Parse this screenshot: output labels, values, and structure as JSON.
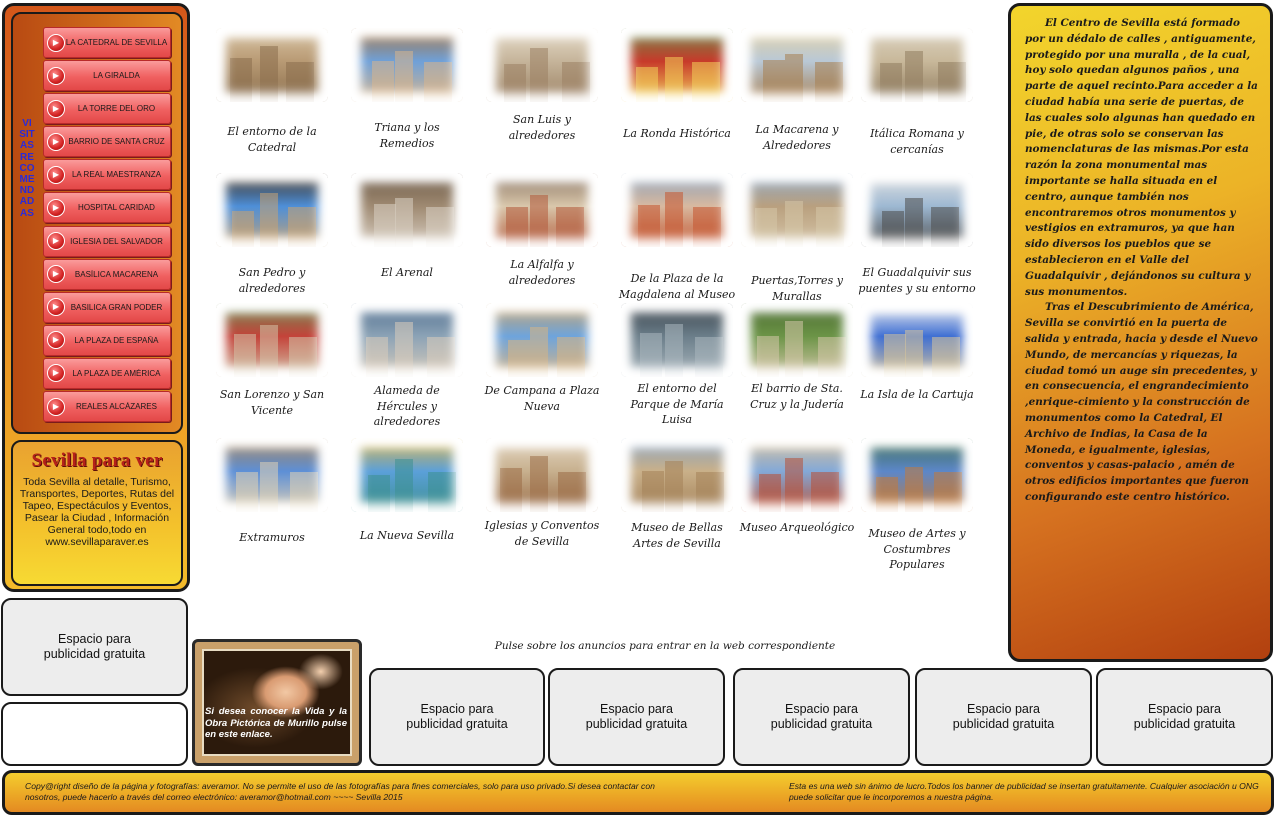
{
  "sidebar": {
    "vertical_title": "VISITAS RECOMENDADAS",
    "items": [
      {
        "label": "LA CATEDRAL DE SEVILLA"
      },
      {
        "label": "LA GIRALDA"
      },
      {
        "label": "LA TORRE DEL ORO"
      },
      {
        "label": "BARRIO DE SANTA CRUZ"
      },
      {
        "label": "LA REAL MAESTRANZA"
      },
      {
        "label": "HOSPITAL  CARIDAD"
      },
      {
        "label": "IGLESIA DEL SALVADOR"
      },
      {
        "label": "BASÍLICA  MACARENA"
      },
      {
        "label": "BASILICA GRAN PODER"
      },
      {
        "label": "LA PLAZA DE ESPAÑA"
      },
      {
        "label": "LA PLAZA DE AMÉRICA"
      },
      {
        "label": "REALES ALCÁZARES"
      }
    ]
  },
  "promo": {
    "title": "Sevilla para ver",
    "text": "Toda Sevilla al detalle, Turismo, Transportes, Deportes, Rutas del Tapeo, Espectáculos y Eventos, Pasear la Ciudad , Información General todo,todo en www.sevillaparaver.es"
  },
  "left_ads": [
    {
      "label": "Espacio para publicidad gratuita"
    },
    {
      "label": ""
    }
  ],
  "murillo": {
    "text": "Si desea conocer la Vida y la Obra Pictórica de Murillo pulse en este enlace."
  },
  "tiles": [
    {
      "label": "El entorno de la Catedral",
      "palette": [
        "#b89a74",
        "#8a6e4d",
        "#d9c5a5"
      ]
    },
    {
      "label": "Triana y los Remedios",
      "palette": [
        "#6fa0d8",
        "#d8b58a",
        "#a4723f"
      ]
    },
    {
      "label": "San Luis y alrededores",
      "palette": [
        "#c5b49a",
        "#9b8062",
        "#e7ddcb"
      ]
    },
    {
      "label": "La Ronda Histórica",
      "palette": [
        "#c73a2a",
        "#f3cf5a",
        "#6b8b4a"
      ]
    },
    {
      "label": "La Macarena y Alrededores",
      "palette": [
        "#b9c8d6",
        "#a57d4f",
        "#e3d2a6"
      ]
    },
    {
      "label": "Itálica Romana y cercanías",
      "palette": [
        "#c8b89a",
        "#8f7b5e",
        "#dcd3c1"
      ]
    },
    {
      "label": "San Pedro y alrededores",
      "palette": [
        "#4e8fd8",
        "#c8a271",
        "#3c2c1c"
      ]
    },
    {
      "label": "El Arenal",
      "palette": [
        "#9f8a72",
        "#d9cfc2",
        "#6b5845"
      ]
    },
    {
      "label": "La Alfalfa y alrededores",
      "palette": [
        "#d9c7ab",
        "#b35a3a",
        "#8a7462"
      ]
    },
    {
      "label": "De la Plaza de la Magdalena al Museo",
      "palette": [
        "#d8b9a0",
        "#c4542e",
        "#8ba0b8"
      ]
    },
    {
      "label": "Puertas,Torres y Murallas",
      "palette": [
        "#b9a07f",
        "#d6c6a8",
        "#8fa7c2"
      ]
    },
    {
      "label": "El Guadalquivir sus puentes y su entorno",
      "palette": [
        "#9db8d2",
        "#4d4d4d",
        "#e3e3e3"
      ]
    },
    {
      "label": "San Lorenzo y San Vicente",
      "palette": [
        "#c4433a",
        "#d3c2a8",
        "#6d8d52"
      ]
    },
    {
      "label": "Alameda de Hércules y alrededores",
      "palette": [
        "#8ca3b6",
        "#d9ccbb",
        "#4e6d8e"
      ]
    },
    {
      "label": "De  Campana a Plaza Nueva",
      "palette": [
        "#6ea4dc",
        "#d7b483",
        "#c9a36a"
      ]
    },
    {
      "label": "El entorno del Parque de María Luisa",
      "palette": [
        "#6b7e8a",
        "#a9b6bd",
        "#39424a"
      ]
    },
    {
      "label": "El barrio de Sta. Cruz y la Judería",
      "palette": [
        "#6c9447",
        "#d4c7a8",
        "#4a6a2f"
      ]
    },
    {
      "label": "La Isla de la Cartuja",
      "palette": [
        "#3f6fd3",
        "#d7c49b",
        "#f1f1f1"
      ]
    },
    {
      "label": "Extramuros",
      "palette": [
        "#5d8fd6",
        "#e0d1b4",
        "#a6845a"
      ]
    },
    {
      "label": "La Nueva Sevilla",
      "palette": [
        "#5ba0d9",
        "#3c8f8f",
        "#d9b44a"
      ]
    },
    {
      "label": "Iglesias y Conventos de Sevilla",
      "palette": [
        "#c7b08e",
        "#9a6b46",
        "#e4d7c3"
      ]
    },
    {
      "label": "Museo de Bellas Artes de Sevilla",
      "palette": [
        "#c9b089",
        "#a48158",
        "#8aa3c0"
      ]
    },
    {
      "label": "Museo Arqueológico",
      "palette": [
        "#83a9d8",
        "#b84e34",
        "#d8c09a"
      ]
    },
    {
      "label": "Museo de Artes y Costumbres Populares",
      "palette": [
        "#5c87c9",
        "#c27a3b",
        "#3d6e54"
      ]
    }
  ],
  "history": {
    "paragraph1": "El Centro de Sevilla  está formado por un dédalo de calles , antiguamente,   protegido por una muralla , de la cual, hoy solo quedan algunos paños , una parte de aquel recinto.Para acceder a la ciudad había una serie de puertas, de las cuales solo  algunas han quedado en pie, de otras solo se conservan las nomenclaturas de las mismas.Por esta razón la zona monumental mas importante se halla situada en el centro, aunque también nos encontraremos otros monumentos y vestigios en extramuros, ya que han sido diversos los pueblos que se establecieron en el Valle del Guadalquivir , dejándonos su cultura y sus monumentos.",
    "paragraph2": "Tras  el Descubrimiento de América, Sevilla se convirtió en la puerta de salida y entrada, hacia y desde el Nuevo Mundo, de mercancías y riquezas, la ciudad tomó un auge sin precedentes, y en consecuencia, el engrandecimiento ,enrique-cimiento y la construcción de monumentos como la Catedral, El Archivo de Indias, la Casa de la Moneda, e igualmente, iglesias, conventos y casas-palacio , amén de otros edificios importantes que fueron configurando este centro histórico."
  },
  "ads_hint": "Pulse sobre los anuncios para entrar en la web correspondiente",
  "bottom_ads": [
    {
      "label": "Espacio para publicidad gratuita"
    },
    {
      "label": "Espacio para publicidad gratuita"
    },
    {
      "label": "Espacio para publicidad gratuita"
    },
    {
      "label": "Espacio para publicidad gratuita"
    },
    {
      "label": "Espacio para publicidad gratuita"
    }
  ],
  "footer": {
    "left": "Copy@right diseño de la página y fotografías: averamor. No se permite el uso de las fotografías para fines comerciales, solo para uso privado.Si desea contactar con nosotros, puede hacerlo a través del correo electrónico: averamor@hotmail.com ~~~~ Sevilla 2015",
    "right": "Esta es una web sin ánimo de lucro.Todos los banner de publicidad se insertan gratuitamente. Cualquier asociación u ONG puede solicitar que le incorporemos a nuestra página."
  }
}
